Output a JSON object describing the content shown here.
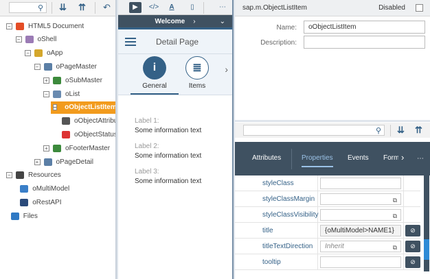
{
  "tree": {
    "search_placeholder": "",
    "nodes": [
      {
        "label": "HTML5 Document",
        "level": 0,
        "expander": "-",
        "icon": "html5-icon",
        "color": "#e44d26"
      },
      {
        "label": "oShell",
        "level": 1,
        "expander": "-",
        "icon": "shell-icon",
        "color": "#9b7bb5"
      },
      {
        "label": "oApp",
        "level": 2,
        "expander": "-",
        "icon": "app-icon",
        "color": "#d4a72c"
      },
      {
        "label": "oPageMaster",
        "level": 3,
        "expander": "-",
        "icon": "page-icon",
        "color": "#5b7fa6"
      },
      {
        "label": "oSubMaster",
        "level": 4,
        "expander": "+",
        "icon": "subheader-icon",
        "color": "#3c8a3c"
      },
      {
        "label": "oList",
        "level": 4,
        "expander": "-",
        "icon": "list-icon",
        "color": "#6a8bb0"
      },
      {
        "label": "oObjectListItem",
        "level": 5,
        "expander": "-",
        "icon": "object-list-item-icon",
        "color": "#555",
        "selected": true
      },
      {
        "label": "oObjectAttribute",
        "level": 6,
        "expander": "",
        "icon": "object-attribute-icon",
        "color": "#555"
      },
      {
        "label": "oObjectStatus",
        "level": 6,
        "expander": "",
        "icon": "object-status-icon",
        "color": "#d33"
      },
      {
        "label": "oFooterMaster",
        "level": 4,
        "expander": "+",
        "icon": "footer-icon",
        "color": "#3c8a3c"
      },
      {
        "label": "oPageDetail",
        "level": 3,
        "expander": "+",
        "icon": "page-icon",
        "color": "#5b7fa6"
      },
      {
        "label": "Resources",
        "level": 0,
        "expander": "-",
        "icon": "resources-icon",
        "color": "#444"
      },
      {
        "label": "oMultiModel",
        "level": 1.5,
        "expander": "",
        "icon": "model-icon",
        "color": "#3a7fc8"
      },
      {
        "label": "oRestAPI",
        "level": 1.5,
        "expander": "",
        "icon": "rest-api-icon",
        "color": "#2a4a7a"
      },
      {
        "label": "Files",
        "level": 0.5,
        "expander": "",
        "icon": "files-icon",
        "color": "#2f79c4"
      }
    ]
  },
  "preview": {
    "nav_title": "Welcome",
    "page_title": "Detail Page",
    "tabs": [
      {
        "label": "General",
        "icon": "i"
      },
      {
        "label": "Items",
        "icon": "≣"
      }
    ],
    "fields": [
      {
        "label": "Label 1:",
        "value": "Some information text"
      },
      {
        "label": "Label 2:",
        "value": "Some information text"
      },
      {
        "label": "Label 3:",
        "value": "Some information text"
      }
    ]
  },
  "inspector": {
    "class_name": "sap.m.ObjectListItem",
    "disabled_label": "Disabled",
    "name_label": "Name:",
    "name_value": "oObjectListItem",
    "description_label": "Description:",
    "description_value": ""
  },
  "properties": {
    "tabs": [
      "Attributes",
      "Properties",
      "Events",
      "Form"
    ],
    "active_tab": "Properties",
    "rows": [
      {
        "name": "styleClass",
        "value": "",
        "placeholder": "",
        "copy": false,
        "unbind": false
      },
      {
        "name": "styleClassMargin",
        "value": "",
        "placeholder": "",
        "copy": true,
        "unbind": false
      },
      {
        "name": "styleClassVisibility",
        "value": "",
        "placeholder": "",
        "copy": true,
        "unbind": false
      },
      {
        "name": "title",
        "value": "{oMultiModel>NAME1}",
        "placeholder": "",
        "copy": false,
        "unbind": true
      },
      {
        "name": "titleTextDirection",
        "value": "",
        "placeholder": "Inherit",
        "copy": true,
        "unbind": true
      },
      {
        "name": "tooltip",
        "value": "",
        "placeholder": "",
        "copy": false,
        "unbind": true
      }
    ]
  }
}
